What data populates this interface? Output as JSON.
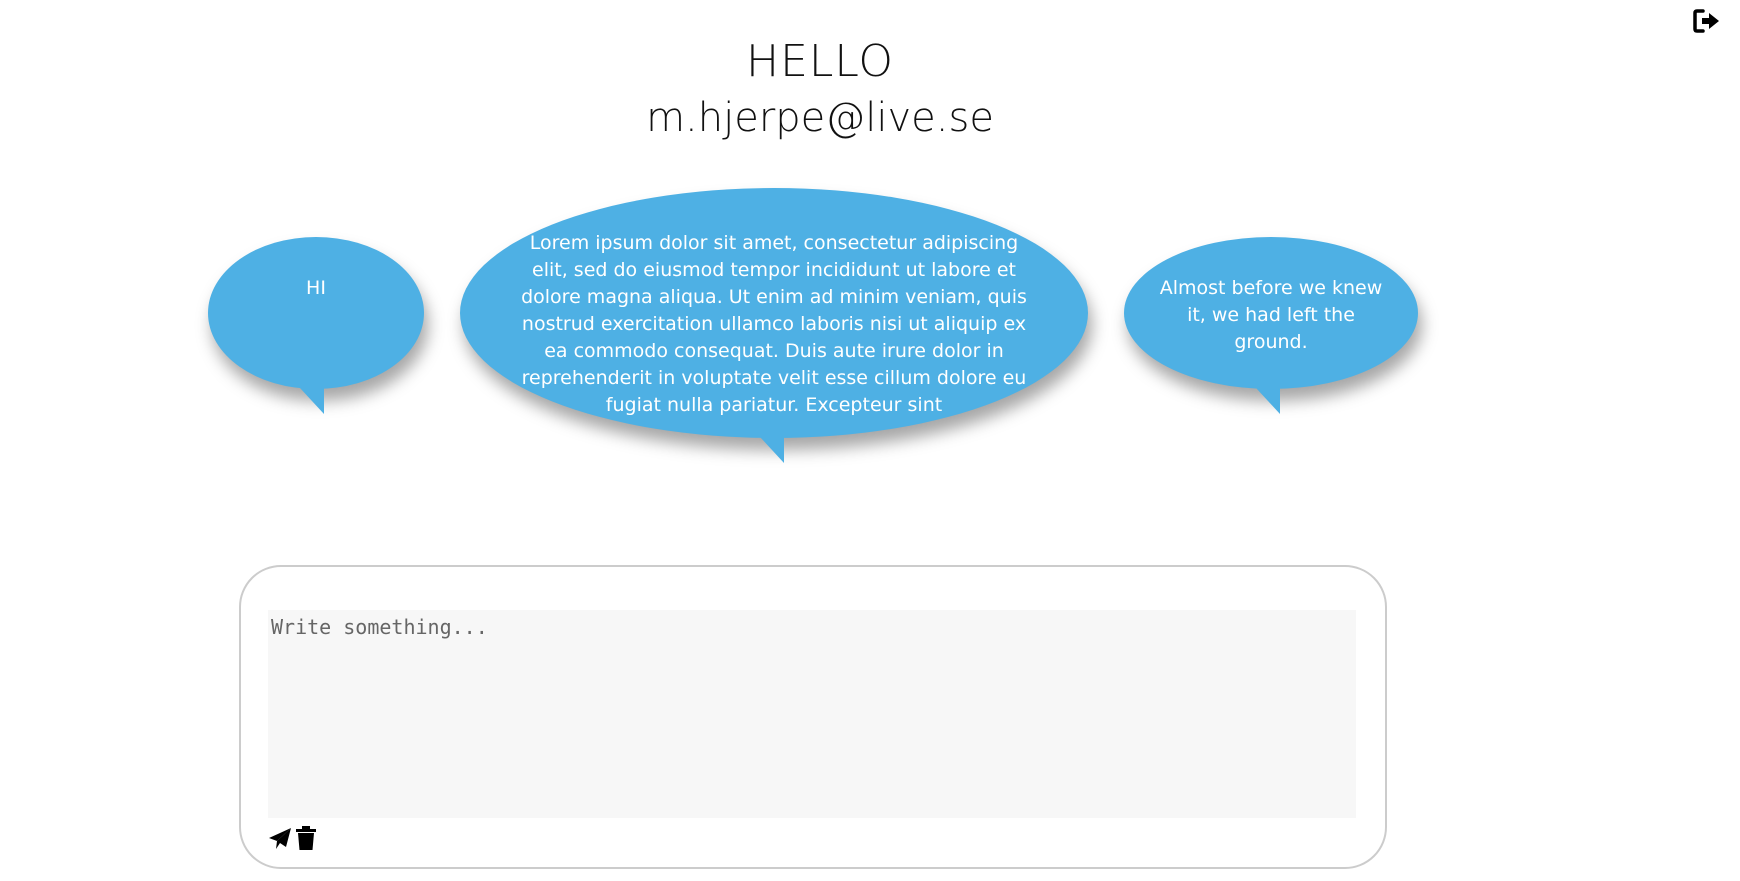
{
  "header": {
    "greeting": "HELLO",
    "email": "m.hjerpe@live.se",
    "logout_icon": "sign-out-icon"
  },
  "bubbles": [
    {
      "text": "HI"
    },
    {
      "text": "Lorem ipsum dolor sit amet, consectetur adipiscing elit, sed do eiusmod tempor incididunt ut labore et dolore magna aliqua. Ut enim ad minim veniam, quis nostrud exercitation ullamco laboris nisi ut aliquip ex ea commodo consequat. Duis aute irure dolor in reprehenderit in voluptate velit esse cillum dolore eu fugiat nulla pariatur. Excepteur sint"
    },
    {
      "text": "Almost before we knew it, we had left the ground."
    }
  ],
  "composer": {
    "placeholder": "Write something...",
    "value": "",
    "send_icon": "paper-plane-icon",
    "delete_icon": "trash-icon"
  },
  "colors": {
    "bubble": "#4eb0e4",
    "bubble_text": "#ffffff",
    "composer_border": "#cccccc",
    "textarea_bg": "#f7f7f7"
  }
}
